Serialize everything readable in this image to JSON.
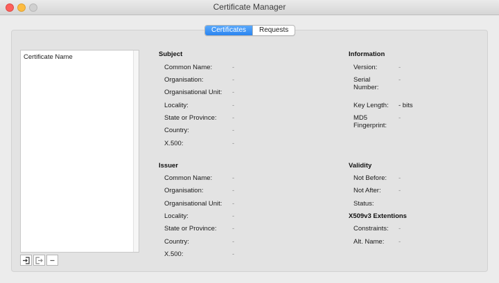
{
  "window": {
    "title": "Certificate Manager"
  },
  "tabs": [
    {
      "label": "Certificates",
      "active": true
    },
    {
      "label": "Requests",
      "active": false
    }
  ],
  "certificate_list": {
    "column_header": "Certificate Name",
    "buttons": [
      {
        "icon": "import-icon"
      },
      {
        "icon": "export-icon"
      },
      {
        "icon": "minus-icon"
      }
    ]
  },
  "subject": {
    "title": "Subject",
    "fields": [
      {
        "label": "Common Name:",
        "value": "-"
      },
      {
        "label": "Organisation:",
        "value": "-"
      },
      {
        "label": "Organisational Unit:",
        "value": "-"
      },
      {
        "label": "Locality:",
        "value": "-"
      },
      {
        "label": "State or Province:",
        "value": "-"
      },
      {
        "label": "Country:",
        "value": "-"
      },
      {
        "label": "X.500:",
        "value": "-"
      }
    ]
  },
  "issuer": {
    "title": "Issuer",
    "fields": [
      {
        "label": "Common Name:",
        "value": "-"
      },
      {
        "label": "Organisation:",
        "value": "-"
      },
      {
        "label": "Organisational Unit:",
        "value": "-"
      },
      {
        "label": "Locality:",
        "value": "-"
      },
      {
        "label": "State or Province:",
        "value": "-"
      },
      {
        "label": "Country:",
        "value": "-"
      },
      {
        "label": "X.500:",
        "value": "-"
      }
    ]
  },
  "information": {
    "title": "Information",
    "fields": [
      {
        "label": "Version:",
        "value": "-"
      },
      {
        "label": "Serial Number:",
        "value": "-"
      },
      {
        "label": "Key Length:",
        "value": "- bits"
      },
      {
        "label": "MD5 Fingerprint:",
        "value": "-"
      }
    ]
  },
  "validity": {
    "title": "Validity",
    "fields": [
      {
        "label": "Not Before:",
        "value": "-"
      },
      {
        "label": "Not After:",
        "value": "-"
      },
      {
        "label": "Status:",
        "value": ""
      }
    ]
  },
  "extensions": {
    "title": "X509v3 Extentions",
    "fields": [
      {
        "label": "Constraints:",
        "value": "-"
      },
      {
        "label": "Alt. Name:",
        "value": "-"
      }
    ]
  },
  "colors": {
    "accent": "#2a84f0",
    "panel": "#e3e3e3",
    "muted_value": "#8a8a8a"
  }
}
